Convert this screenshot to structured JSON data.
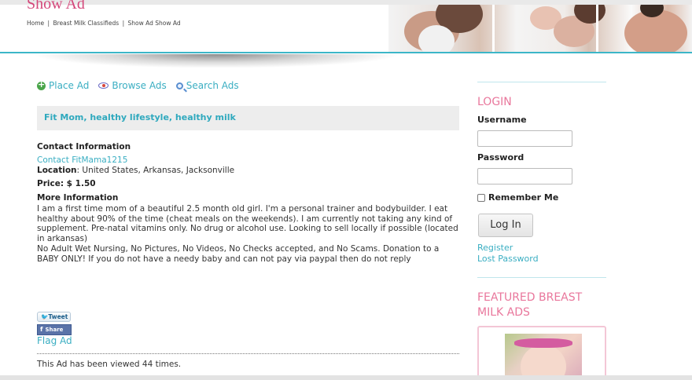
{
  "header": {
    "page_title": "Show Ad",
    "breadcrumb": [
      "Home",
      "|",
      "Breast Milk Classifieds",
      "|",
      "Show Ad Show Ad"
    ]
  },
  "actions": {
    "place_ad": "Place Ad",
    "browse_ads": "Browse Ads",
    "search_ads": "Search Ads"
  },
  "ad": {
    "title": "Fit Mom, healthy lifestyle, healthy milk",
    "contact_heading": "Contact Information",
    "contact_link": "Contact FitMama1215",
    "location_label": "Location",
    "location_value": ": United States, Arkansas, Jacksonville",
    "price_label": "Price",
    "price_value": ": $ 1.50",
    "more_heading": "More Information",
    "description": "I am a first time mom of a beautiful 2.5 month old girl. I'm a personal trainer and bodybuilder. I eat healthy about 90% of the time (cheat meals on the weekends). I am currently not taking any kind of supplement. Pre-natal vitamins only. No drug or alcohol use. Looking to sell locally if possible (located in arkansas)",
    "rules": "No Adult Wet Nursing, No Pictures, No Videos, No Checks accepted, and No Scams. Donation to a BABY ONLY! If you do not have a needy baby and can not pay via paypal then do not reply",
    "tweet_label": "Tweet",
    "share_label": "Share",
    "flag_label": "Flag Ad",
    "views_text": "This Ad has been viewed 44 times."
  },
  "sidebar": {
    "login_heading": "LOGIN",
    "username_label": "Username",
    "password_label": "Password",
    "remember_label": "Remember Me",
    "login_button": "Log In",
    "register_link": "Register",
    "lost_password_link": "Lost Password",
    "featured_heading_1": "FEATURED BREAST",
    "featured_heading_2": "MILK ADS"
  },
  "colors": {
    "accent": "#3aaec2",
    "title_pink": "#d4477a",
    "sidebar_heading": "#e9779c"
  },
  "icons": [
    "plus-circle-icon",
    "eye-icon",
    "search-icon",
    "twitter-bird-icon",
    "facebook-icon"
  ]
}
